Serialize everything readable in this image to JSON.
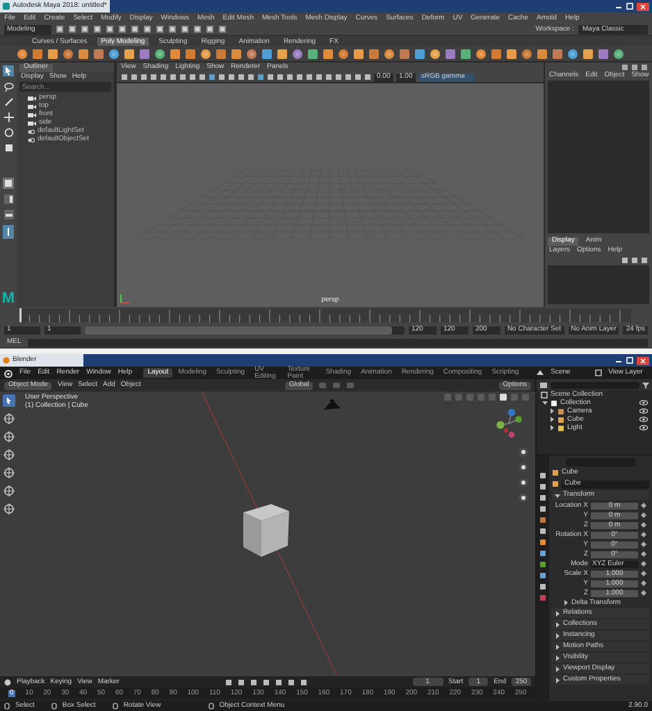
{
  "maya": {
    "title": "Autodesk Maya 2018: untitled*",
    "menus": [
      "File",
      "Edit",
      "Create",
      "Select",
      "Modify",
      "Display",
      "Windows",
      "Mesh",
      "Edit Mesh",
      "Mesh Tools",
      "Mesh Display",
      "Curves",
      "Surfaces",
      "Deform",
      "UV",
      "Generate",
      "Cache",
      "Arnold",
      "Help"
    ],
    "mode": "Modeling",
    "workspace_label": "Workspace :",
    "workspace": "Maya Classic",
    "shelf_tabs": [
      {
        "label": "Curves / Surfaces",
        "selected": false
      },
      {
        "label": "Poly Modeling",
        "selected": true
      },
      {
        "label": "Sculpting",
        "selected": false
      },
      {
        "label": "Rigging",
        "selected": false
      },
      {
        "label": "Animation",
        "selected": false
      },
      {
        "label": "Rendering",
        "selected": false
      },
      {
        "label": "FX",
        "selected": false
      }
    ],
    "outliner": {
      "title": "Outliner",
      "menus": [
        "Display",
        "Show",
        "Help"
      ],
      "search_placeholder": "Search...",
      "items": [
        {
          "label": "persp",
          "kind": "camera"
        },
        {
          "label": "top",
          "kind": "camera"
        },
        {
          "label": "front",
          "kind": "camera"
        },
        {
          "label": "side",
          "kind": "camera"
        },
        {
          "label": "defaultLightSet",
          "kind": "set"
        },
        {
          "label": "defaultObjectSet",
          "kind": "set"
        }
      ]
    },
    "panel_menus": [
      "View",
      "Shading",
      "Lighting",
      "Show",
      "Renderer",
      "Panels"
    ],
    "panel_fields": [
      "0.00",
      "1.00"
    ],
    "color_space": "sRGB gamma",
    "viewport_label": "persp",
    "channel_box": {
      "menus": [
        "Channels",
        "Edit",
        "Object",
        "Show"
      ]
    },
    "layer_editor": {
      "tabs": [
        {
          "label": "Display",
          "selected": true
        },
        {
          "label": "Anim",
          "selected": false
        }
      ],
      "menus": [
        "Layers",
        "Options",
        "Help"
      ]
    },
    "logo": "M",
    "range_fields": [
      "1",
      "1",
      "120",
      "120",
      "200"
    ],
    "range_slider": {
      "level": 0.96
    },
    "character_set": "No Character Set",
    "anim_layer": "No Anim Layer",
    "fps": "24 fps",
    "command_label": "MEL"
  },
  "blender": {
    "title": "Blender",
    "menus": [
      "File",
      "Edit",
      "Render",
      "Window",
      "Help"
    ],
    "workspaces": [
      {
        "label": "Layout",
        "selected": true
      },
      {
        "label": "Modeling",
        "selected": false
      },
      {
        "label": "Sculpting",
        "selected": false
      },
      {
        "label": "UV Editing",
        "selected": false
      },
      {
        "label": "Texture Paint",
        "selected": false
      },
      {
        "label": "Shading",
        "selected": false
      },
      {
        "label": "Animation",
        "selected": false
      },
      {
        "label": "Rendering",
        "selected": false
      },
      {
        "label": "Compositing",
        "selected": false
      },
      {
        "label": "Scripting",
        "selected": false
      }
    ],
    "scene": "Scene",
    "view_layer": "View Layer",
    "mode": "Object Mode",
    "view_menus": [
      "View",
      "Select",
      "Add",
      "Object"
    ],
    "orientation": "Global",
    "options": "Options",
    "overlay_lines": [
      "User Perspective",
      "(1) Collection | Cube"
    ],
    "outliner": {
      "root": "Scene Collection",
      "items": [
        {
          "label": "Collection",
          "kind": "collection",
          "expanded": true,
          "children": [
            {
              "label": "Camera",
              "kind": "camera",
              "expanded": false
            },
            {
              "label": "Cube",
              "kind": "mesh",
              "expanded": false
            },
            {
              "label": "Light",
              "kind": "light",
              "expanded": false
            }
          ]
        }
      ]
    },
    "properties": {
      "header": "Cube",
      "name_field": "Cube",
      "panels": [
        {
          "label": "Transform",
          "expanded": true,
          "fields": [
            {
              "label": "Location X",
              "value": "0 m",
              "kind": "number"
            },
            {
              "label": "Y",
              "value": "0 m",
              "kind": "number"
            },
            {
              "label": "Z",
              "value": "0 m",
              "kind": "number"
            },
            {
              "label": "Rotation X",
              "value": "0°",
              "kind": "number"
            },
            {
              "label": "Y",
              "value": "0°",
              "kind": "number"
            },
            {
              "label": "Z",
              "value": "0°",
              "kind": "number"
            },
            {
              "label": "Mode",
              "value": "XYZ Euler",
              "kind": "dropdown"
            },
            {
              "label": "Scale X",
              "value": "1.000",
              "kind": "number"
            },
            {
              "label": "Y",
              "value": "1.000",
              "kind": "number"
            },
            {
              "label": "Z",
              "value": "1.000",
              "kind": "number"
            }
          ],
          "subpanels": [
            {
              "label": "Delta Transform",
              "expanded": false
            }
          ]
        },
        {
          "label": "Relations",
          "expanded": false
        },
        {
          "label": "Collections",
          "expanded": false
        },
        {
          "label": "Instancing",
          "expanded": false
        },
        {
          "label": "Motion Paths",
          "expanded": false
        },
        {
          "label": "Visibility",
          "expanded": false
        },
        {
          "label": "Viewport Display",
          "expanded": false
        },
        {
          "label": "Custom Properties",
          "expanded": false
        }
      ]
    },
    "timeline": {
      "menus": [
        "Playback",
        "Keying",
        "View",
        "Marker"
      ],
      "current_frame": "1",
      "start_label": "Start",
      "start": "1",
      "end_label": "End",
      "end": "250",
      "ticks": [
        "0",
        "10",
        "20",
        "30",
        "40",
        "50",
        "60",
        "70",
        "80",
        "90",
        "100",
        "110",
        "120",
        "130",
        "140",
        "150",
        "160",
        "170",
        "180",
        "190",
        "200",
        "210",
        "220",
        "230",
        "240",
        "250"
      ]
    },
    "status": [
      "Select",
      "Box Select",
      "Rotate View",
      "Object Context Menu"
    ],
    "version": "2.90.0"
  }
}
